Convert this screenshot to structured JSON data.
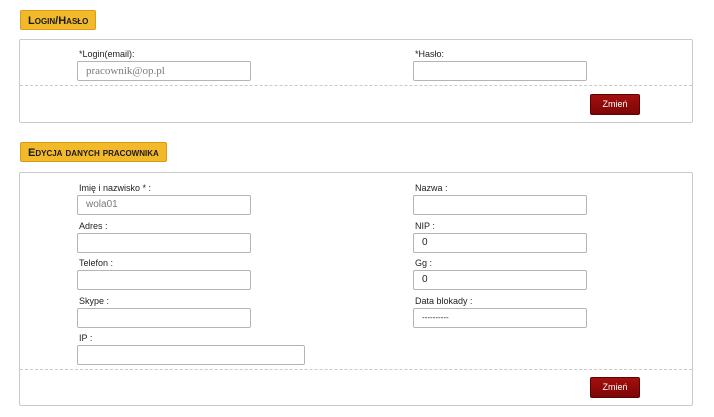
{
  "login_section": {
    "title": "Login/Hasło",
    "login_label": "*Login(email):",
    "login_value": "pracownik@op.pl",
    "password_label": "*Hasło:",
    "password_value": "",
    "submit_label": "Zmień"
  },
  "employee_section": {
    "title": "Edycja danych pracownika",
    "name_label": "Imię i nazwisko * :",
    "name_value": "wola01",
    "company_label": "Nazwa :",
    "company_value": "",
    "address_label": "Adres :",
    "address_value": "",
    "nip_label": "NIP :",
    "nip_value": "0",
    "phone_label": "Telefon :",
    "phone_value": "",
    "gg_label": "Gg :",
    "gg_value": "0",
    "skype_label": "Skype :",
    "skype_value": "",
    "block_date_label": "Data blokady :",
    "block_date_value": "----------",
    "ip_label": "IP :",
    "ip_value": "",
    "submit_label": "Zmień"
  }
}
